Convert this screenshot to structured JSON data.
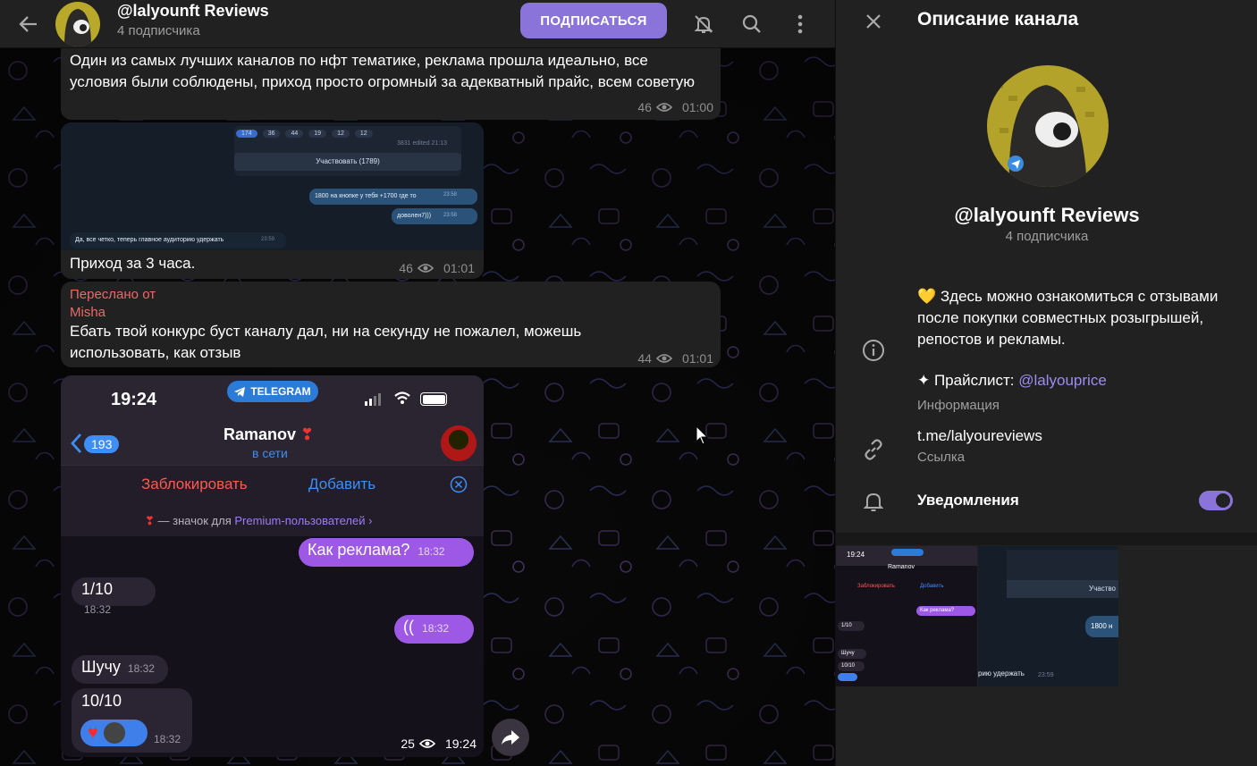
{
  "header": {
    "title": "@lalyounft Reviews",
    "subtitle": "4 подписчика",
    "subscribe_label": "ПОДПИСАТЬСЯ",
    "icons": [
      "back-arrow-icon",
      "bell-off-icon",
      "search-icon",
      "more-vertical-icon"
    ]
  },
  "messages": [
    {
      "text": "Один из самых лучших каналов по нфт тематике, реклама прошла идеально, все условия были соблюдены, приход просто огромный за адекватный прайс, всем советую",
      "views": "46",
      "time": "01:00"
    },
    {
      "caption": "Приход за 3 часа.",
      "views": "46",
      "time": "01:01",
      "image": {
        "reactions": [
          "174",
          "36",
          "44",
          "19",
          "12",
          "12"
        ],
        "views_edited": "3831  edited 21:13",
        "button": "Участвовать (1789)",
        "bubbles": [
          {
            "text": "1800 на кнопке у тебя +1700 где то",
            "time": "23:58"
          },
          {
            "text": "доволен7)))",
            "time": "23:58"
          },
          {
            "text": "Да, все четко, теперь главное аудиторию удержать",
            "time": "23:59"
          }
        ]
      }
    },
    {
      "forwarded_label": "Переслано от",
      "forwarded_from": "Misha",
      "text": "Ебать твой конкурс буст каналу дал, ни на секунду не пожалел, можешь использовать, как отзыв",
      "views": "44",
      "time": "01:01"
    },
    {
      "views": "25",
      "time": "19:24",
      "screenshot": {
        "status_time": "19:24",
        "telegram_badge": "TELEGRAM",
        "back_count": "193",
        "contact_name": "Ramanov",
        "contact_status": "в сети",
        "block_label": "Заблокировать",
        "add_label": "Добавить",
        "premium_note": "— значок для",
        "premium_link": "Premium-пользователей",
        "chat": [
          {
            "text": "Как реклама?",
            "time": "18:32",
            "out": true
          },
          {
            "text": "1/10",
            "time": "18:32",
            "out": false
          },
          {
            "text": "((",
            "time": "18:32",
            "out": true
          },
          {
            "text": "Шучу",
            "time": "18:32",
            "out": false
          },
          {
            "text": "10/10",
            "time": "18:32",
            "out": false
          }
        ]
      }
    }
  ],
  "info": {
    "title": "Описание канала",
    "channel_name": "@lalyounft Reviews",
    "subscribers": "4 подписчика",
    "description": "💛 Здесь можно ознакомиться с отзывами после покупки совместных розыгрышей, репостов и рекламы.",
    "pricelist_prefix": "✦ Прайслист: ",
    "pricelist_link": "@lalyouprice",
    "info_label": "Информация",
    "link_value": "t.me/lalyoureviews",
    "link_label": "Ссылка",
    "notifications_label": "Уведомления",
    "notifications_on": true
  },
  "media_thumbs": [
    {
      "status_time": "19:24",
      "name": "Ramanov",
      "block": "Заблокировать",
      "add": "Добавить",
      "out_text": "Как реклама?",
      "in_text": "1/10",
      "shuchu": "Шучу",
      "ten": "10/10"
    },
    {
      "button": "Участво",
      "bubble": "1800 н",
      "footer": "рию удержать",
      "time": "23:59"
    }
  ],
  "colors": {
    "accent": "#8b74d9",
    "bubble": "#212121",
    "link": "#9e8cf2",
    "forward": "#e86a6a"
  }
}
